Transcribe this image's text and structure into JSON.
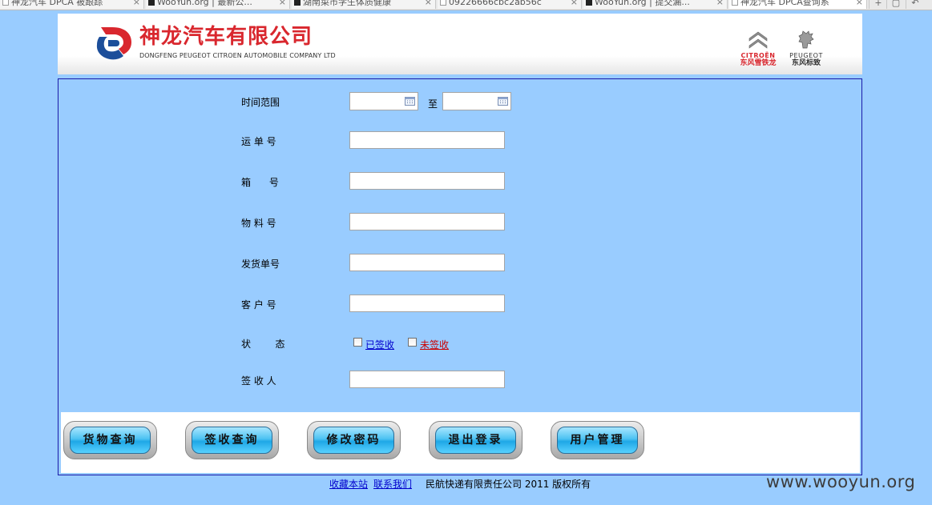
{
  "browser": {
    "tabs": [
      {
        "title": "神龙汽车 DPCA 被跟踪",
        "active": false
      },
      {
        "title": "WooYun.org | 最新公...",
        "active": false
      },
      {
        "title": "湖南菜市学生体质健康",
        "active": false
      },
      {
        "title": "09226666cbc2ab56c",
        "active": false
      },
      {
        "title": "WooYun.org | 提交漏...",
        "active": false
      },
      {
        "title": "神龙汽车 DPCA查询系",
        "active": true
      }
    ],
    "close_glyph": "×",
    "new_tab_glyph": "+",
    "menu_glyph": "▢",
    "back_glyph": "↶"
  },
  "header": {
    "company_name": "神龙汽车有限公司",
    "company_name_en": "DONGFENG PEUGEOT CITROEN AUTOMOBILE COMPANY LTD",
    "citroen_en": "CITROËN",
    "citroen_cn": "东风雪铁龙",
    "peugeot_en": "PEUGEOT",
    "peugeot_cn": "东风标致"
  },
  "form": {
    "time_range_label": "时间范围",
    "time_range_sep": "至",
    "waybill_label": "运 单 号",
    "box_label": "箱      号",
    "material_label": "物 料 号",
    "shipment_label": "发货单号",
    "customer_label": "客 户 号",
    "status_label": "状        态",
    "status_signed": "已签收",
    "status_unsigned": "未签收",
    "receiver_label": "签 收 人",
    "values": {
      "date_from": "",
      "date_to": "",
      "waybill": "",
      "box": "",
      "material": "",
      "shipment": "",
      "customer": "",
      "receiver": ""
    }
  },
  "buttons": {
    "cargo_query": "货物查询",
    "sign_query": "签收查询",
    "change_password": "修改密码",
    "logout": "退出登录",
    "user_manage": "用户管理"
  },
  "footer": {
    "bookmark": "收藏本站",
    "contact": "联系我们",
    "copyright": "民航快递有限责任公司 2011 版权所有"
  },
  "watermark": "www.wooyun.org",
  "colors": {
    "page_bg": "#99ccff",
    "brand_red": "#d9272e",
    "brand_blue": "#1c4e9a",
    "signed_text": "#0000cc",
    "unsigned_text": "#cc0000",
    "panel_border": "#1a1aa8"
  }
}
